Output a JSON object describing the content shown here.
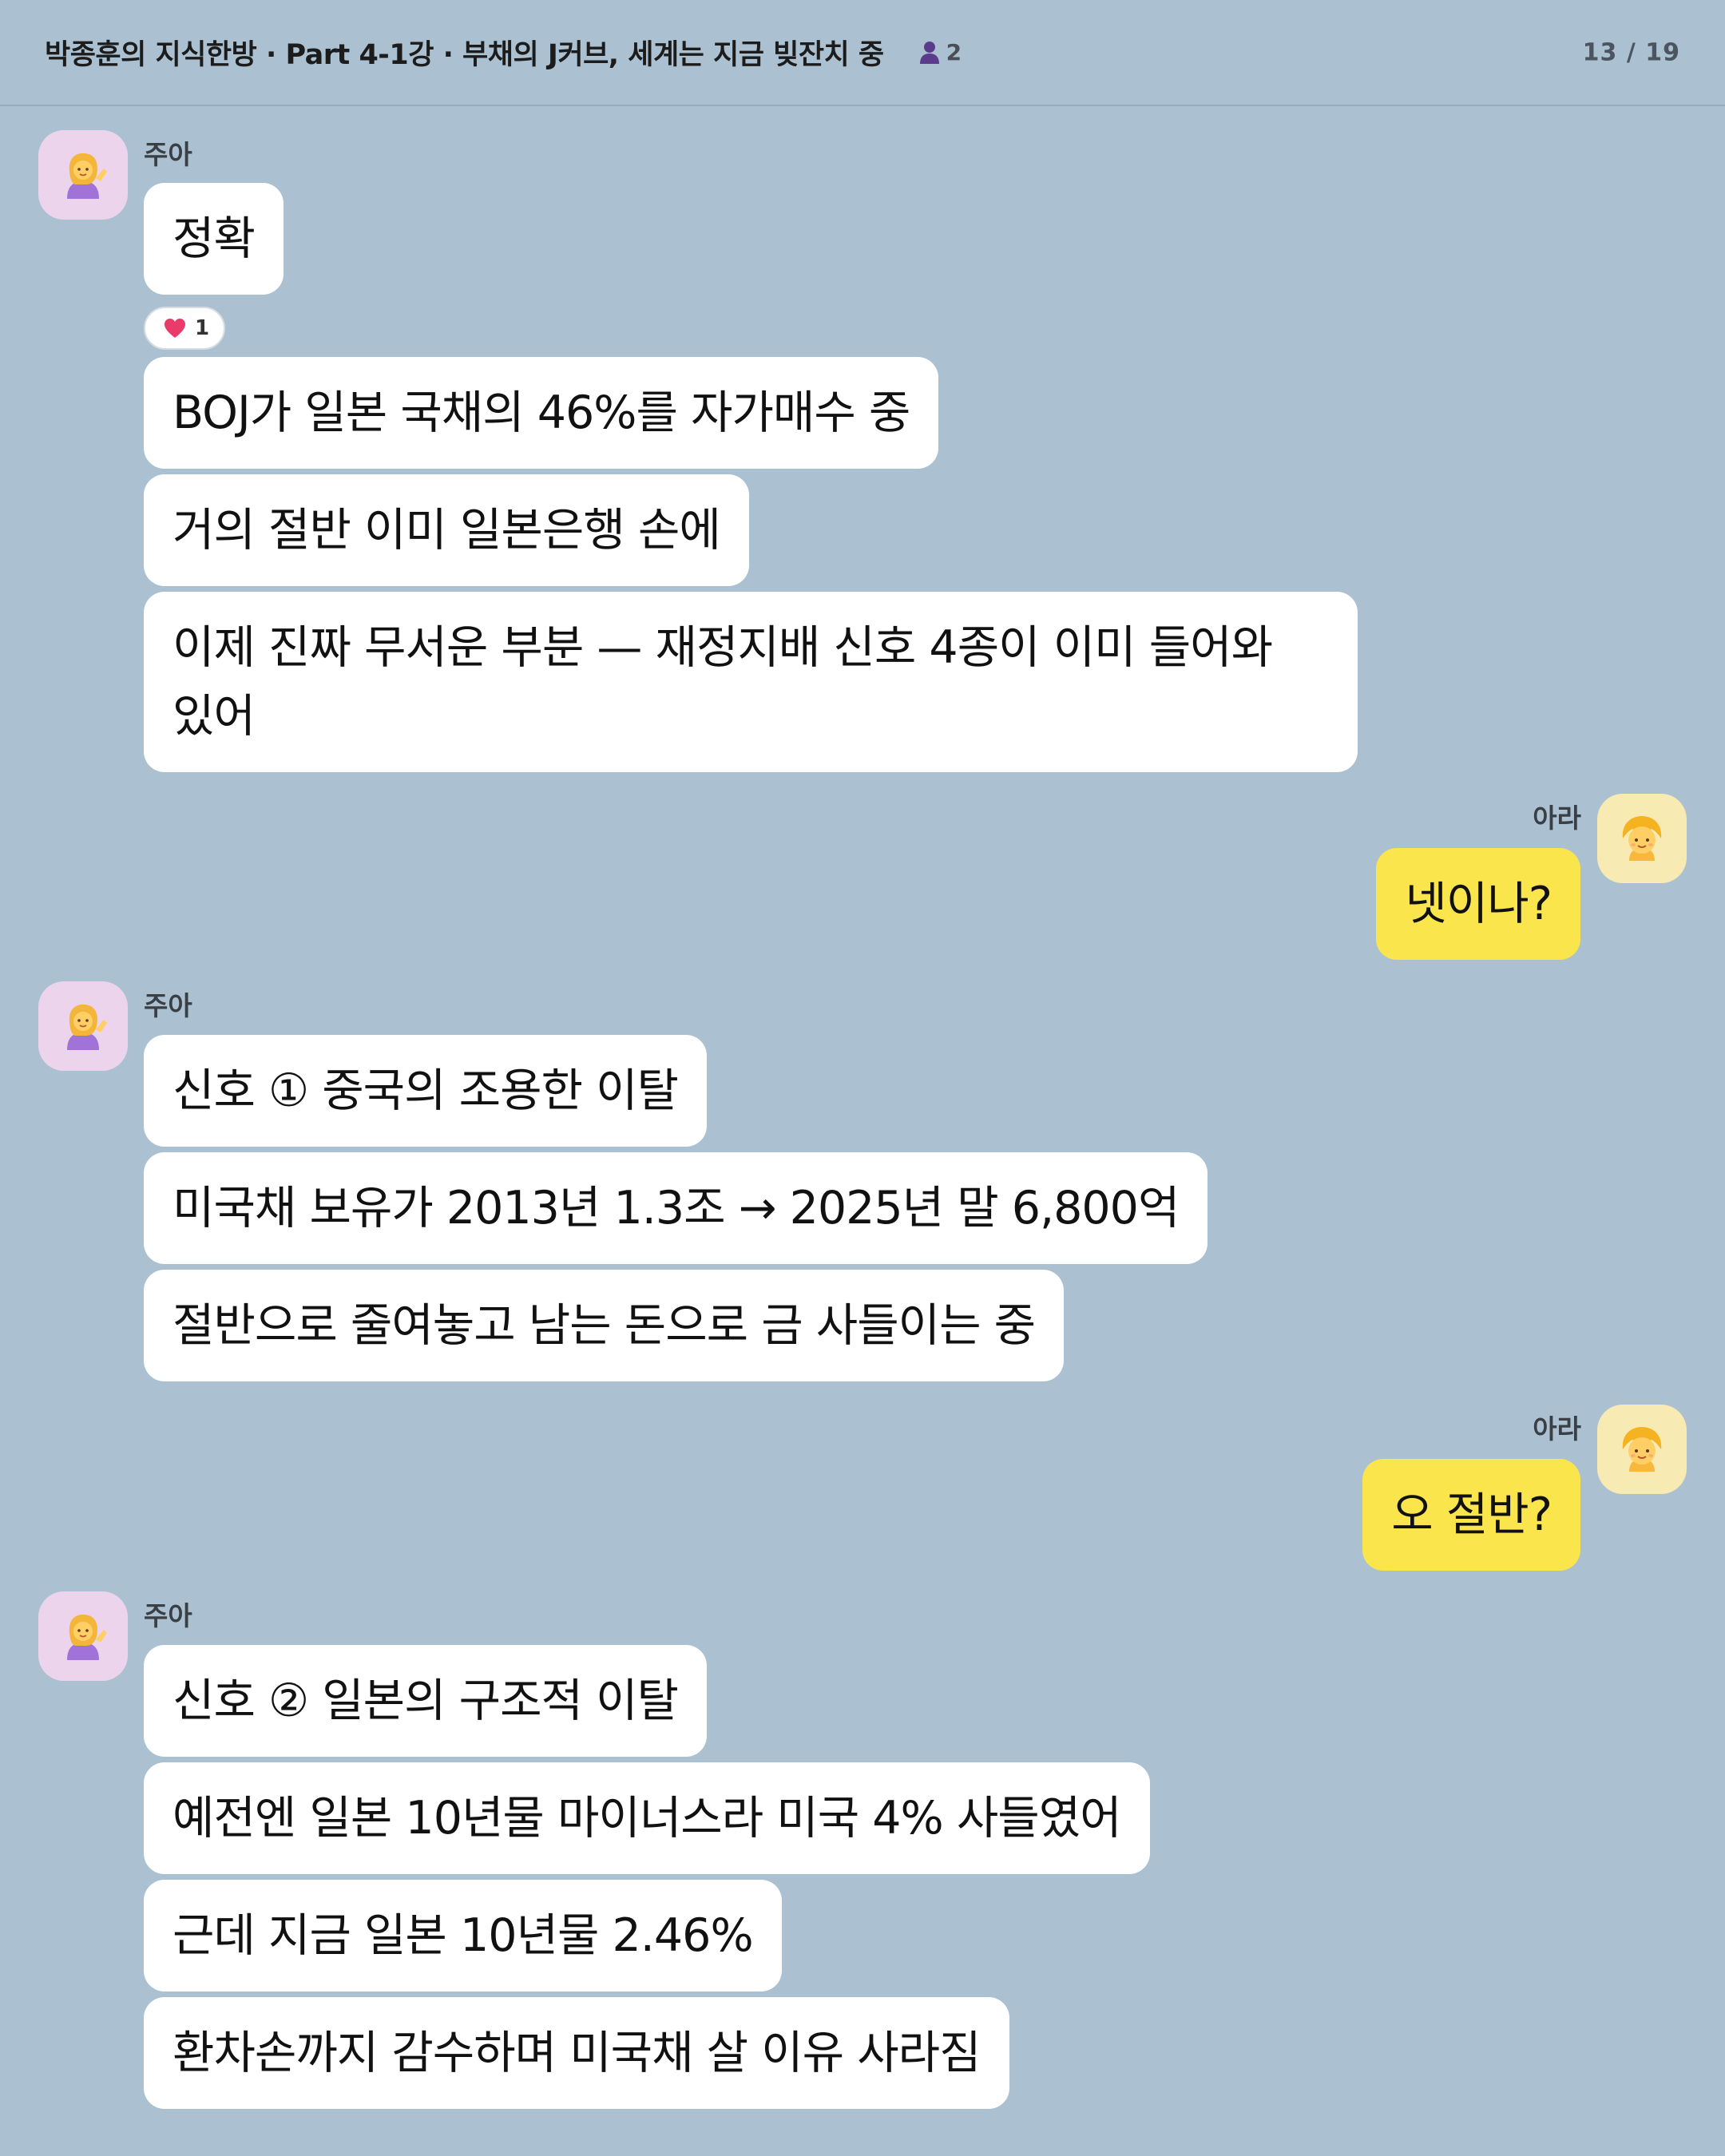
{
  "header": {
    "title": "박종훈의 지식한방 · Part 4-1강 · 부채의 J커브, 세계는 지금 빚잔치 중",
    "member_count": "2",
    "page_indicator": "13 / 19"
  },
  "colors": {
    "background": "#abc1d1",
    "incoming_bubble": "#ffffff",
    "outgoing_bubble": "#fae54d"
  },
  "messages": [
    {
      "sender": "주아",
      "side": "left",
      "avatar_icon": "woman-tipping-hand-icon",
      "bubbles": [
        "정확"
      ],
      "reaction": {
        "icon": "heart-icon",
        "count": "1"
      }
    },
    {
      "sender": "",
      "side": "left",
      "bubbles": [
        "BOJ가 일본 국채의 46%를 자가매수 중",
        "거의 절반 이미 일본은행 손에",
        "이제 진짜 무서운 부분 — 재정지배 신호 4종이 이미 들어와있어"
      ]
    },
    {
      "sender": "아라",
      "side": "right",
      "avatar_icon": "child-face-icon",
      "bubbles": [
        "넷이나?"
      ]
    },
    {
      "sender": "주아",
      "side": "left",
      "avatar_icon": "woman-tipping-hand-icon",
      "bubbles": [
        "신호 ① 중국의 조용한 이탈",
        "미국채 보유가 2013년 1.3조 → 2025년 말 6,800억",
        "절반으로 줄여놓고 남는 돈으로 금 사들이는 중"
      ]
    },
    {
      "sender": "아라",
      "side": "right",
      "avatar_icon": "child-face-icon",
      "bubbles": [
        "오 절반?"
      ]
    },
    {
      "sender": "주아",
      "side": "left",
      "avatar_icon": "woman-tipping-hand-icon",
      "bubbles": [
        "신호 ② 일본의 구조적 이탈",
        "예전엔 일본 10년물 마이너스라 미국 4% 사들였어",
        "근데 지금 일본 10년물 2.46%",
        "환차손까지 감수하며 미국채 살 이유 사라짐"
      ]
    }
  ]
}
